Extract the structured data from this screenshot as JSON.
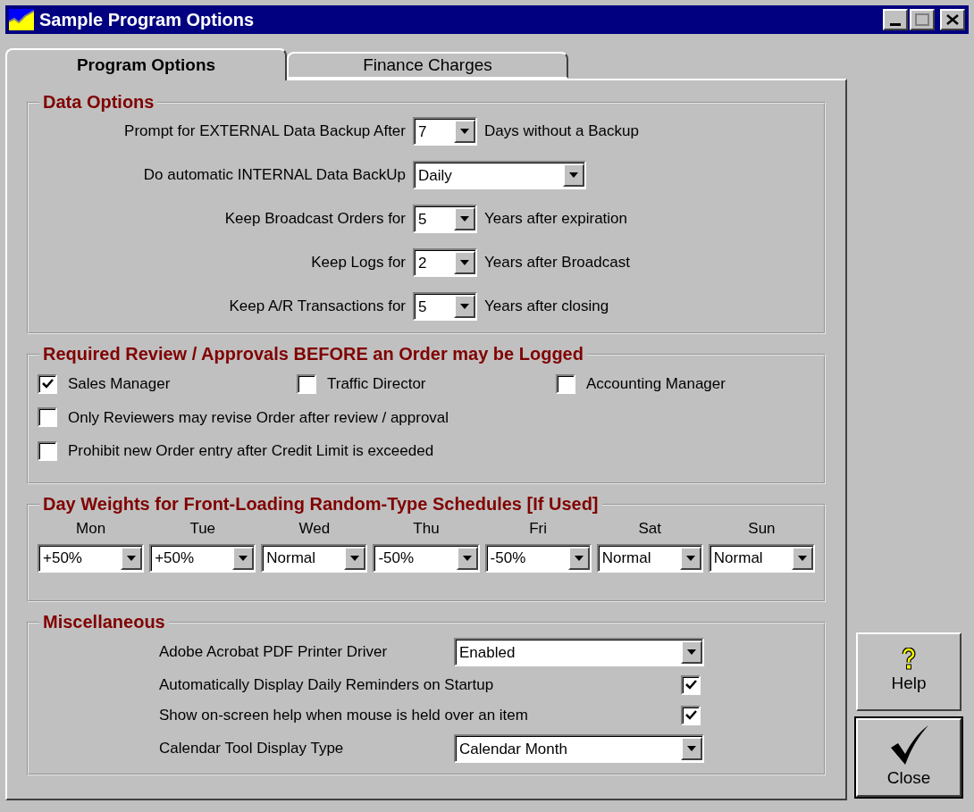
{
  "window": {
    "title": "Sample Program Options"
  },
  "tabs": [
    {
      "label": "Program Options",
      "selected": true
    },
    {
      "label": "Finance Charges",
      "selected": false
    }
  ],
  "data_options": {
    "title": "Data Options",
    "rows": [
      {
        "label": "Prompt for EXTERNAL Data Backup After",
        "value": "7",
        "kind": "narrow",
        "suffix": "Days without a Backup"
      },
      {
        "label": "Do automatic INTERNAL Data BackUp",
        "value": "Daily",
        "kind": "wide"
      },
      {
        "label": "Keep Broadcast Orders for",
        "value": "5",
        "kind": "narrow",
        "suffix": "Years after expiration"
      },
      {
        "label": "Keep Logs for",
        "value": "2",
        "kind": "narrow",
        "suffix": "Years after Broadcast"
      },
      {
        "label": "Keep A/R Transactions for",
        "value": "5",
        "kind": "narrow",
        "suffix": "Years after closing"
      }
    ]
  },
  "review": {
    "title": "Required Review / Approvals BEFORE an Order may be Logged",
    "rows": [
      {
        "items": [
          {
            "label": "Sales Manager",
            "checked": true
          },
          {
            "label": "Traffic Director",
            "checked": false
          },
          {
            "label": "Accounting Manager",
            "checked": false
          }
        ]
      },
      {
        "items": [
          {
            "label": "Only Reviewers may revise Order after review / approval",
            "checked": false
          }
        ]
      },
      {
        "items": [
          {
            "label": "Prohibit new Order entry after Credit Limit is exceeded",
            "checked": false
          }
        ]
      }
    ]
  },
  "day_weights": {
    "title": "Day Weights for Front-Loading Random-Type Schedules [If Used]",
    "days": [
      {
        "day": "Mon",
        "value": "+50%"
      },
      {
        "day": "Tue",
        "value": "+50%"
      },
      {
        "day": "Wed",
        "value": "Normal"
      },
      {
        "day": "Thu",
        "value": "-50%"
      },
      {
        "day": "Fri",
        "value": "-50%"
      },
      {
        "day": "Sat",
        "value": "Normal"
      },
      {
        "day": "Sun",
        "value": "Normal"
      }
    ]
  },
  "misc": {
    "title": "Miscellaneous",
    "rows": [
      {
        "kind": "select",
        "label": "Adobe Acrobat PDF Printer Driver",
        "value": "Enabled"
      },
      {
        "kind": "checkbox",
        "label": "Automatically Display Daily Reminders on Startup",
        "checked": true
      },
      {
        "kind": "checkbox",
        "label": "Show on-screen help when mouse is held over an item",
        "checked": true
      },
      {
        "kind": "select",
        "label": "Calendar Tool Display Type",
        "value": "Calendar Month"
      }
    ]
  },
  "buttons": [
    {
      "kind": "help",
      "label": "Help",
      "default": false
    },
    {
      "kind": "close",
      "label": "Close",
      "default": true
    }
  ]
}
